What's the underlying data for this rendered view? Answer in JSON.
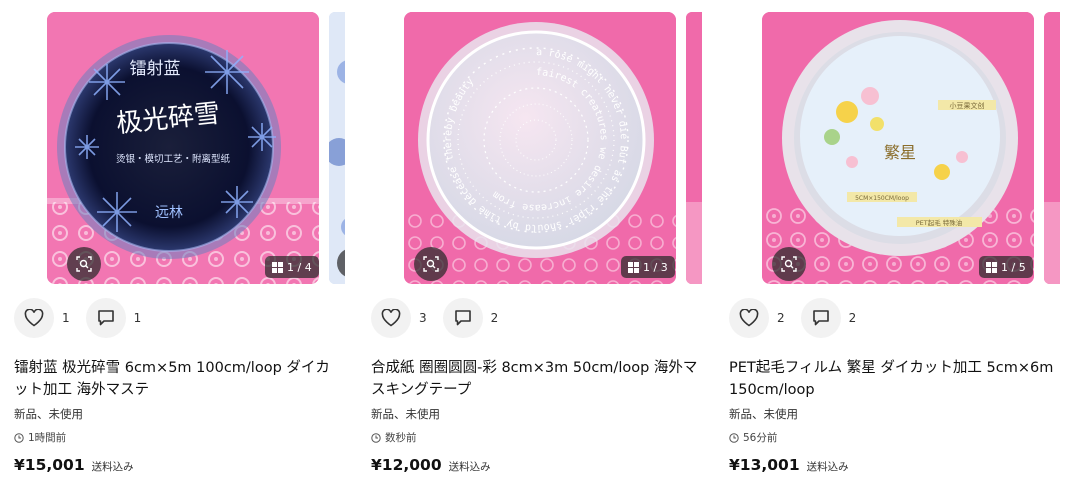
{
  "icons": {
    "heart": "heart-icon",
    "comment": "comment-icon",
    "lens": "image-search-icon",
    "grid": "grid-icon",
    "clock": "clock-icon"
  },
  "colors": {
    "photo_background": "#f07ab0",
    "overlay": "#282828",
    "button_bg": "#f2f2f2"
  },
  "items": [
    {
      "image_counter": "1 / 4",
      "likes": "1",
      "comments": "1",
      "title": "镭射蓝 极光碎雪 6cm×5m 100cm/loop ダイカット加工 海外マステ",
      "condition": "新品、未使用",
      "posted": "1時間前",
      "price": "¥15,001",
      "shipping": "送料込み",
      "tape_text": {
        "line1": "镭射蓝",
        "line2": "极光碎雪",
        "line3": "烫银・模切工艺・附离型纸",
        "brand": "远林"
      }
    },
    {
      "image_counter": "1 / 3",
      "likes": "3",
      "comments": "2",
      "title": "合成紙 圈圈圆圆-彩 8cm×3m 50cm/loop 海外マスキングテープ",
      "condition": "新品、未使用",
      "posted": "数秒前",
      "price": "¥12,000",
      "shipping": "送料込み",
      "tape_text": {
        "ring1": "a rose might never die But as the riper should by time decease thereby beauty",
        "ring2": "fairest creatures we desire increase from"
      }
    },
    {
      "image_counter": "1 / 5",
      "likes": "2",
      "comments": "2",
      "title": "PET起毛フィルム 繁星 ダイカット加工 5cm×6m 150cm/loop",
      "condition": "新品、未使用",
      "posted": "56分前",
      "price": "¥13,001",
      "shipping": "送料込み",
      "tape_text": {
        "name": "繁星",
        "tag1": "小豆果文创",
        "tag2": "5CM×150CM/loop",
        "tag3": "PET起毛 特殊油"
      }
    }
  ]
}
